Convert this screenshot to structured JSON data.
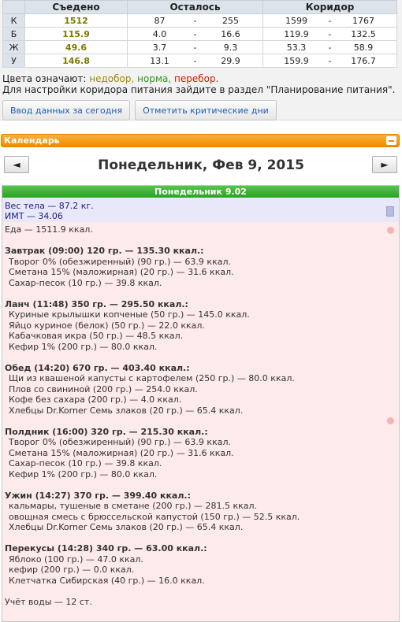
{
  "macro": {
    "headers": [
      "",
      "Съедено",
      "Осталось",
      "Коридор"
    ],
    "rows": [
      {
        "label": "К",
        "eaten": "1512",
        "rem_a": "87",
        "rem_sep": "-",
        "rem_b": "255",
        "cor_a": "1599",
        "cor_sep": "-",
        "cor_b": "1767"
      },
      {
        "label": "Б",
        "eaten": "115.9",
        "rem_a": "4.0",
        "rem_sep": "-",
        "rem_b": "16.6",
        "cor_a": "119.9",
        "cor_sep": "-",
        "cor_b": "132.5"
      },
      {
        "label": "Ж",
        "eaten": "49.6",
        "rem_a": "3.7",
        "rem_sep": "-",
        "rem_b": "9.3",
        "cor_a": "53.3",
        "cor_sep": "-",
        "cor_b": "58.9"
      },
      {
        "label": "У",
        "eaten": "146.8",
        "rem_a": "13.1",
        "rem_sep": "-",
        "rem_b": "29.9",
        "cor_a": "159.9",
        "cor_sep": "-",
        "cor_b": "176.7"
      }
    ]
  },
  "legend": {
    "prefix": "Цвета означают:",
    "under": "недобор,",
    "norm": "норма,",
    "over": "перебор.",
    "hint": "Для настройки коридора питания зайдите в раздел \"Планирование питания\"."
  },
  "buttons": {
    "enter_today": "Ввод данных за сегодня",
    "mark_critical": "Отметить критические дни"
  },
  "calendar": {
    "title": "Календарь",
    "prev": "◄",
    "next": "►",
    "date": "Понедельник, Фев 9, 2015"
  },
  "day": {
    "header": "Понедельник 9.02",
    "weight": "Вес тела — 87.2 кг.",
    "bmi": "ИМТ — 34.06",
    "food_total": "Еда — 1511.9 ккал.",
    "meals": [
      {
        "title": "Завтрак (09:00) 120 гр. — 135.30 ккал.:",
        "items": [
          "Творог 0% (обезжиренный) (90 гр.) — 63.9 ккал.",
          "Сметана 15% (маложирная) (20 гр.) — 31.6 ккал.",
          "Сахар-песок (10 гр.) — 39.8 ккал."
        ]
      },
      {
        "title": "Ланч (11:48) 350 гр. — 295.50 ккал.:",
        "items": [
          "Куриные крылышки копченые (50 гр.) — 145.0 ккал.",
          "Яйцо куриное (белок) (50 гр.) — 22.0 ккал.",
          "Кабачковая икра (50 гр.) — 48.5 ккал.",
          "Кефир 1% (200 гр.) — 80.0 ккал."
        ]
      },
      {
        "title": "Обед (14:20) 670 гр. — 403.40 ккал.:",
        "items": [
          "Щи из квашеной капусты с картофелем (250 гр.) — 80.0 ккал.",
          "Плов со свининой (200 гр.) — 254.0 ккал.",
          "Кофе без сахара (200 гр.) — 4.0 ккал.",
          "Хлебцы Dr.Korner Семь злаков (20 гр.) — 65.4 ккал."
        ]
      },
      {
        "title": "Полдник (16:00) 320 гр. — 215.30 ккал.:",
        "items": [
          "Творог 0% (обезжиренный) (90 гр.) — 63.9 ккал.",
          "Сметана 15% (маложирная) (20 гр.) — 31.6 ккал.",
          "Сахар-песок (10 гр.) — 39.8 ккал.",
          "Кефир 1% (200 гр.) — 80.0 ккал."
        ]
      },
      {
        "title": "Ужин (14:27) 370 гр. — 399.40 ккал.:",
        "items": [
          "кальмары, тушеные в сметане (200 гр.) — 281.5 ккал.",
          "овощная смесь с брюссельской капустой (150 гр.) — 52.5 ккал.",
          "Хлебцы Dr.Korner Семь злаков (20 гр.) — 65.4 ккал."
        ]
      },
      {
        "title": "Перекусы (14:28) 340 гр. — 63.00 ккал.:",
        "items": [
          "Яблоко (100 гр.) — 47.0 ккал.",
          "кефир (200 гр.) — 0.0 ккал.",
          "Клетчатка Сибирская (40 гр.) — 16.0 ккал."
        ]
      }
    ],
    "water": "Учёт воды — 12 ст."
  }
}
